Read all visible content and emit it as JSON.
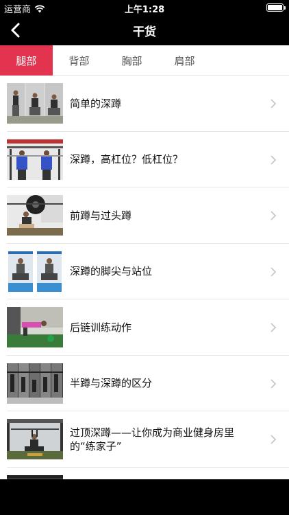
{
  "status": {
    "carrier": "运营商",
    "time": "上午1:28"
  },
  "nav": {
    "title": "干货",
    "back_icon": "chevron-left-icon"
  },
  "tabs": [
    {
      "label": "腿部",
      "active": true
    },
    {
      "label": "背部",
      "active": false
    },
    {
      "label": "胸部",
      "active": false
    },
    {
      "label": "肩部",
      "active": false
    }
  ],
  "items": [
    {
      "title": "简单的深蹲",
      "thumbnail": "squat-sequence-photo"
    },
    {
      "title": "深蹲，高杠位？低杠位？",
      "thumbnail": "barbell-back-view-photo"
    },
    {
      "title": "前蹲与过头蹲",
      "thumbnail": "front-squat-plates-photo"
    },
    {
      "title": "深蹲的脚尖与站位",
      "thumbnail": "squat-stance-photo"
    },
    {
      "title": "后链训练动作",
      "thumbnail": "posterior-chain-photo"
    },
    {
      "title": "半蹲与深蹲的区分",
      "thumbnail": "half-vs-full-squat-photo"
    },
    {
      "title": "过顶深蹲——让你成为商业健身房里的“练家子”",
      "thumbnail": "overhead-squat-photo"
    },
    {
      "title": "",
      "thumbnail": "partial-item-photo"
    }
  ],
  "colors": {
    "accent": "#e2334f",
    "bar": "#000000"
  }
}
